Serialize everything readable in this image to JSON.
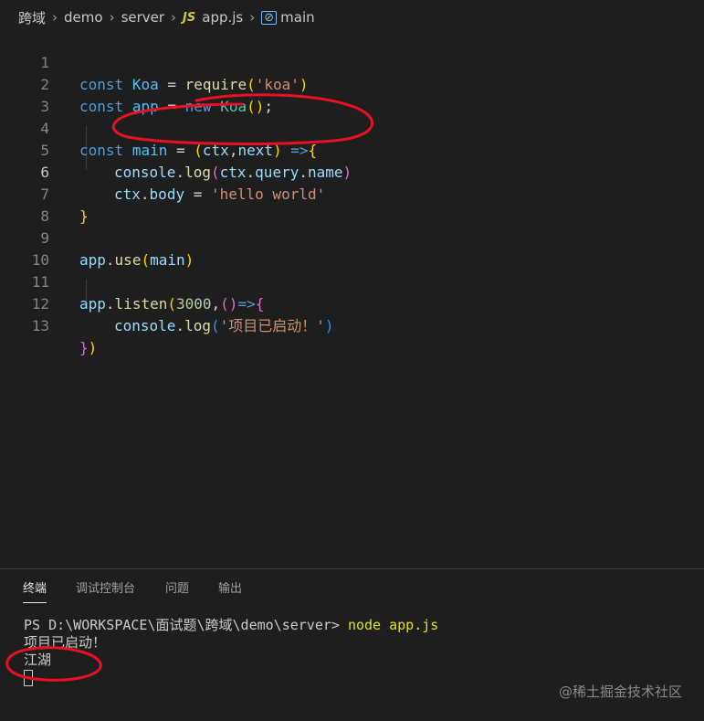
{
  "breadcrumb": {
    "items": [
      "跨域",
      "demo",
      "server",
      "app.js",
      "main"
    ],
    "separator": ">",
    "file_icon": "JS",
    "symbol_icon": "[⊘]"
  },
  "editor": {
    "active_line": 6,
    "lines": [
      {
        "n": "1"
      },
      {
        "n": "2"
      },
      {
        "n": "3"
      },
      {
        "n": "4"
      },
      {
        "n": "5"
      },
      {
        "n": "6"
      },
      {
        "n": "7"
      },
      {
        "n": "8"
      },
      {
        "n": "9"
      },
      {
        "n": "10"
      },
      {
        "n": "11"
      },
      {
        "n": "12"
      },
      {
        "n": "13"
      }
    ],
    "tokens": {
      "l1": {
        "kw": "const",
        "name": "Koa",
        "eq": "=",
        "fn": "require",
        "open": "(",
        "str": "'koa'",
        "close": ")"
      },
      "l2": {
        "kw": "const",
        "name": "app",
        "eq": "=",
        "new": "new",
        "cls": "Koa",
        "open": "(",
        "close": ")",
        "semi": ";"
      },
      "l4": {
        "kw": "const",
        "name": "main",
        "eq": "=",
        "open": "(",
        "p1": "ctx",
        "comma": ",",
        "p2": "next",
        "close": ")",
        "arrow": "=>",
        "brace": "{"
      },
      "l5": {
        "obj": "console",
        "dot": ".",
        "fn": "log",
        "open": "(",
        "a": "ctx",
        "dot2": ".",
        "b": "query",
        "dot3": ".",
        "c": "name",
        "close": ")"
      },
      "l6": {
        "obj": "ctx",
        "dot": ".",
        "prop": "body",
        "eq": "=",
        "str": "'hello world'"
      },
      "l7": {
        "brace": "}"
      },
      "l9": {
        "obj": "app",
        "dot": ".",
        "fn": "use",
        "open": "(",
        "arg": "main",
        "close": ")"
      },
      "l11": {
        "obj": "app",
        "dot": ".",
        "fn": "listen",
        "open": "(",
        "num": "3000",
        "comma": ",",
        "p_open": "(",
        "p_close": ")",
        "arrow": "=>",
        "brace": "{"
      },
      "l12": {
        "obj": "console",
        "dot": ".",
        "fn": "log",
        "open": "(",
        "str": "'项目已启动！'",
        "close": ")"
      },
      "l13": {
        "brace": "}",
        "close": ")"
      }
    }
  },
  "panel": {
    "tabs": [
      "终端",
      "调试控制台",
      "问题",
      "输出"
    ],
    "active_tab": "终端",
    "terminal": {
      "prompt": "PS D:\\WORKSPACE\\面试题\\跨域\\demo\\server> ",
      "command": "node app.js",
      "output": [
        "项目已启动！",
        "江湖"
      ]
    }
  },
  "watermark": "@稀土掘金技术社区",
  "colors": {
    "background": "#1e1e1e",
    "annotation": "#e81123"
  }
}
